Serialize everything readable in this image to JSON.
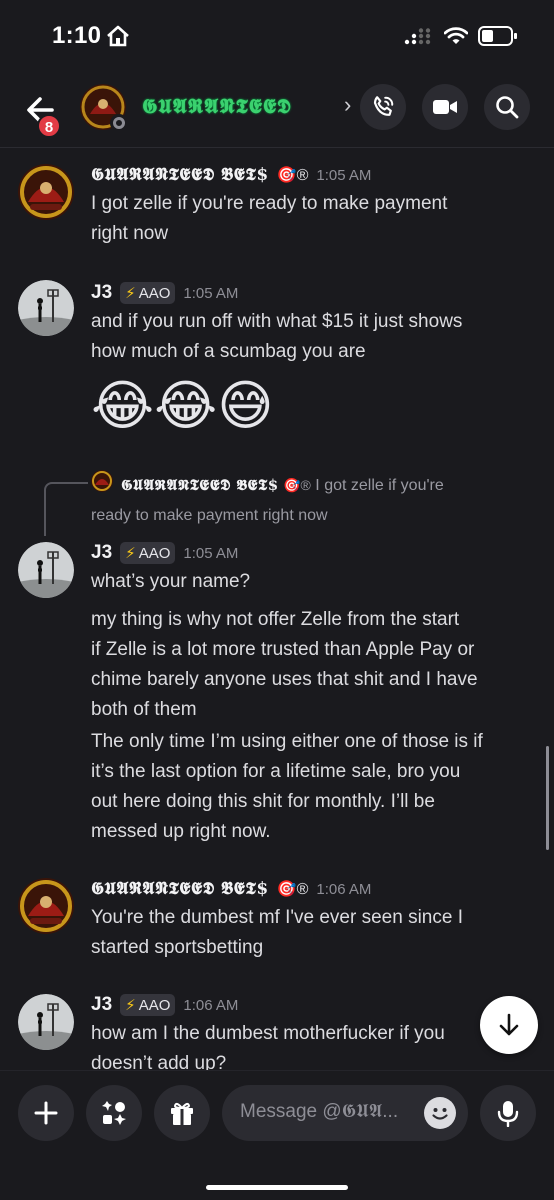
{
  "status_bar": {
    "time": "1:10"
  },
  "header": {
    "back_badge": "8",
    "title": "𝕲𝖀𝕬𝕽𝕬𝕹𝕿𝕰𝕰𝕯",
    "chevron": "›"
  },
  "messages": [
    {
      "author": "𝕲𝖀𝕬𝕽𝕬𝕹𝕿𝕰𝕰𝕯 𝕭𝕰𝕿$",
      "deco": "🎯®",
      "time": "1:05 AM",
      "lines": [
        "I got zelle if you're ready to make payment",
        "right now"
      ]
    },
    {
      "author": "J3",
      "tag": "AAO",
      "time": "1:05 AM",
      "lines": [
        "and if you run off with what $15 it just shows",
        "how much of a scumbag you are"
      ],
      "emojis": "😂😂😅"
    },
    {
      "reply_author": "𝕲𝖀𝕬𝕽𝕬𝕹𝕿𝕰𝕰𝕯 𝕭𝕰𝕿$",
      "reply_deco": "🎯®",
      "reply_text_1": "I got zelle if you're",
      "reply_text_2": "ready to make payment right now",
      "author": "J3",
      "tag": "AAO",
      "time": "1:05 AM",
      "lines": [
        "what’s your name?",
        "my thing is why not offer Zelle from the start",
        "if Zelle is a lot more trusted than Apple Pay or",
        "chime barely anyone uses that shit and I have",
        "both of them",
        "The only time I’m using either one of those is if",
        "it’s the last option for a lifetime sale, bro you",
        "out here doing this shit for monthly. I’ll be",
        "messed up right now."
      ]
    },
    {
      "author": "𝕲𝖀𝕬𝕽𝕬𝕹𝕿𝕰𝕰𝕯 𝕭𝕰𝕿$",
      "deco": "🎯®",
      "time": "1:06 AM",
      "lines": [
        "You're the dumbest mf I've ever seen since I",
        "started sportsbetting"
      ]
    },
    {
      "author": "J3",
      "tag": "AAO",
      "time": "1:06 AM",
      "lines": [
        "how am I the dumbest motherfucker if you",
        "doesn’t add up?"
      ]
    }
  ],
  "input": {
    "placeholder": "Message @𝕲𝖀𝕬..."
  },
  "colors": {
    "background": "#1a1a1e",
    "title_green": "#3bd16f",
    "badge_red": "#e23b45",
    "tag_bg": "#35353c"
  },
  "icons": [
    "home-icon",
    "signal-icon",
    "wifi-icon",
    "battery-icon",
    "back-arrow-icon",
    "phone-icon",
    "video-icon",
    "search-icon",
    "lightning-icon",
    "arrow-down-icon",
    "plus-icon",
    "apps-icon",
    "gift-icon",
    "emoji-icon",
    "mic-icon"
  ]
}
